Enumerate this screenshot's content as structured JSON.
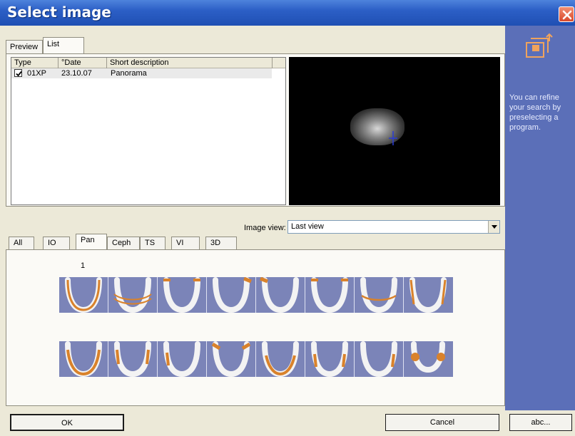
{
  "window": {
    "title": "Select image"
  },
  "tabs_top": [
    "Preview",
    "List"
  ],
  "list": {
    "columns": [
      "Type",
      "°Date",
      "Short description"
    ],
    "rows": [
      {
        "checked": true,
        "type": "01XP",
        "date": "23.10.07",
        "description": "Panorama"
      }
    ]
  },
  "image_view": {
    "label": "Image view:",
    "value": "Last view"
  },
  "program_tabs": [
    "All",
    "IO",
    "Pan",
    "Ceph",
    "TS",
    "VI",
    "3D"
  ],
  "program_group_label": "1",
  "side_panel": {
    "hint": "You can refine your search by preselecting a program."
  },
  "buttons": {
    "ok": "OK",
    "cancel": "Cancel",
    "abc": "abc..."
  },
  "colors": {
    "title_bar": "#2c5fc6",
    "side_panel": "#5b6fb8",
    "thumbnail_bg": "#7b84b8",
    "accent_orange": "#d9822b"
  }
}
